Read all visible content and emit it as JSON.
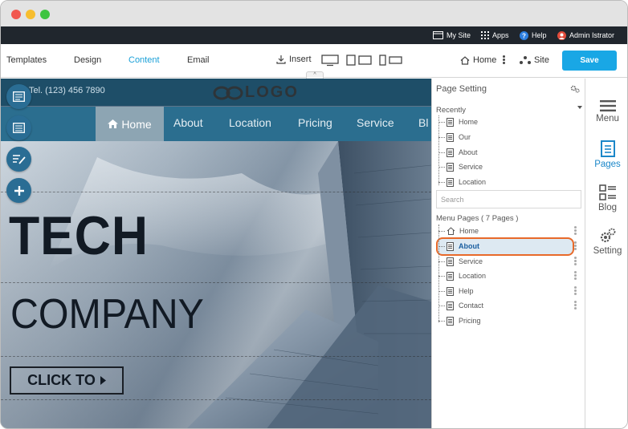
{
  "admin_bar": {
    "my_site": "My Site",
    "apps": "Apps",
    "help": "Help",
    "user": "Admin Istrator"
  },
  "toolbar": {
    "tabs": [
      "Templates",
      "Design",
      "Content",
      "Email"
    ],
    "active_tab": "Content",
    "insert": "Insert",
    "home": "Home",
    "site": "Site",
    "save": "Save"
  },
  "site": {
    "tel": "Tel. (123) 456 7890",
    "logo_text": "LOGO",
    "nav": [
      "Home",
      "About",
      "Location",
      "Pricing",
      "Service",
      "Bl"
    ],
    "hero_title_1": "TECH",
    "hero_title_2": "COMPANY",
    "cta": "CLICK TO"
  },
  "panel": {
    "title": "Page Setting",
    "recently_label": "Recently",
    "recently": [
      "Home",
      "Our",
      "About",
      "Service",
      "Location"
    ],
    "search_placeholder": "Search",
    "menu_pages_label": "Menu Pages ( 7 Pages )",
    "menu_pages": [
      "Home",
      "About",
      "Service",
      "Location",
      "Help",
      "Contact",
      "Pricing"
    ],
    "selected": "About"
  },
  "right_sidebar": {
    "items": [
      "Menu",
      "Pages",
      "Blog",
      "Setting"
    ],
    "active": "Pages"
  },
  "colors": {
    "accent": "#19a7e5",
    "admin_bar": "#20262d",
    "site_header": "#1e4e68",
    "site_nav": "#2b6e8f",
    "highlight": "#e86a2a"
  }
}
